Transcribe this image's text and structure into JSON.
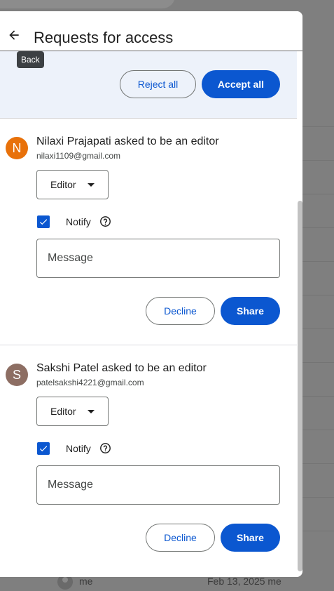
{
  "dialog": {
    "title": "Requests for access",
    "back_tooltip": "Back",
    "reject_all_label": "Reject all",
    "accept_all_label": "Accept all"
  },
  "requests": [
    {
      "initial": "N",
      "avatar_color": "#e8710a",
      "title": "Nilaxi Prajapati asked to be an editor",
      "email": "nilaxi1109@gmail.com",
      "role": "Editor",
      "notify_label": "Notify",
      "notify_checked": true,
      "message_placeholder": "Message",
      "decline_label": "Decline",
      "share_label": "Share"
    },
    {
      "initial": "S",
      "avatar_color": "#8d6e63",
      "title": "Sakshi Patel asked to be an editor",
      "email": "patelsakshi4221@gmail.com",
      "role": "Editor",
      "notify_label": "Notify",
      "notify_checked": true,
      "message_placeholder": "Message",
      "decline_label": "Decline",
      "share_label": "Share"
    }
  ],
  "background": {
    "owner": "me",
    "date": "Feb 13, 2025 me"
  },
  "colors": {
    "accent": "#0b57d0",
    "bulk_bar_bg": "#edf2fa",
    "scrim": "#7f7f7f"
  },
  "icons": {
    "back": "arrow-back-icon",
    "help": "help-circle-icon",
    "dropdown": "caret-down-icon",
    "check": "check-icon"
  }
}
